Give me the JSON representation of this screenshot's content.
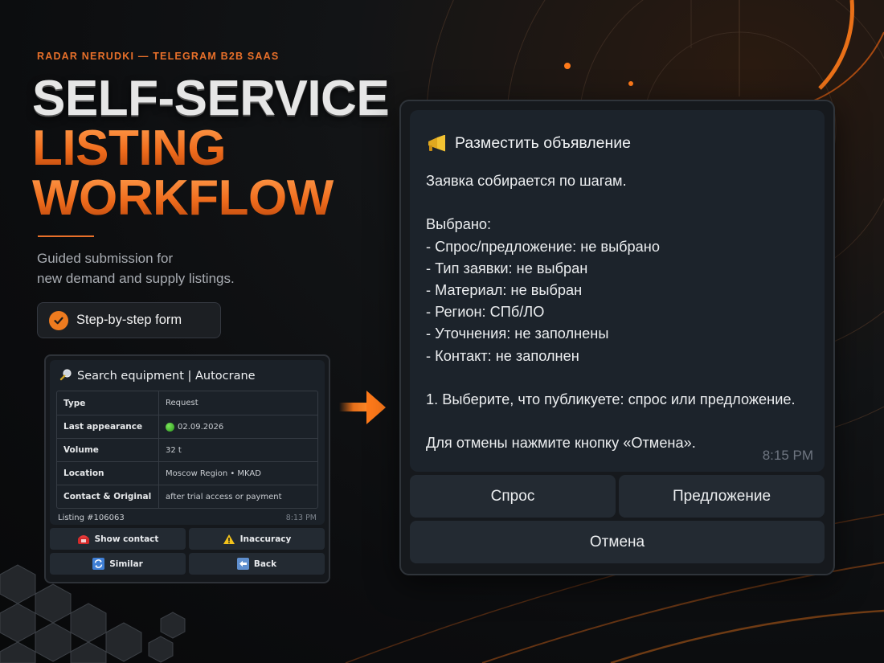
{
  "eyebrow": "RADAR NERUDKI — TELEGRAM B2B SAAS",
  "headline": {
    "line1": "SELF-SERVICE",
    "line2": "LISTING",
    "line3": "WORKFLOW"
  },
  "subtitle": {
    "line1": "Guided submission for",
    "line2": "new demand and supply listings."
  },
  "feature_pill": {
    "icon": "check-circle-icon",
    "label": "Step-by-step form"
  },
  "listing_card": {
    "icon": "magnifier-icon",
    "title": "Search equipment | Autocrane",
    "rows": [
      {
        "key": "Type",
        "value": "Request"
      },
      {
        "key": "Last appearance",
        "value": "02.09.2026",
        "status_icon": "green-dot-icon"
      },
      {
        "key": "Volume",
        "value": "32 t"
      },
      {
        "key": "Location",
        "value": "Moscow Region • MKAD"
      },
      {
        "key": "Contact & Original",
        "value": "after trial access or payment"
      }
    ],
    "listing_id": "Listing #106063",
    "time": "8:13 PM",
    "buttons": [
      {
        "label": "Show contact",
        "icon": "telephone-icon"
      },
      {
        "label": "Inaccuracy",
        "icon": "warning-icon"
      },
      {
        "label": "Similar",
        "icon": "repeat-icon"
      },
      {
        "label": "Back",
        "icon": "back-arrow-icon"
      }
    ]
  },
  "bot_message": {
    "icon": "megaphone-icon",
    "title": "Разместить объявление",
    "intro": "Заявка собирается по шагам.",
    "selected_label": "Выбрано:",
    "items": [
      "- Спрос/предложение: не выбрано",
      "- Тип заявки: не выбран",
      "- Материал: не выбран",
      "- Регион: СПб/ЛО",
      "- Уточнения: не заполнены",
      "- Контакт: не заполнен"
    ],
    "step": "1. Выберите, что публикуете: спрос или предложение.",
    "cancel_hint": "Для отмены нажмите кнопку «Отмена».",
    "time": "8:15 PM",
    "buttons": {
      "demand": "Спрос",
      "offer": "Предложение",
      "cancel": "Отмена"
    }
  },
  "colors": {
    "accent": "#ee6b1c",
    "card_bg": "#1c232b",
    "button_bg": "#232a32"
  }
}
